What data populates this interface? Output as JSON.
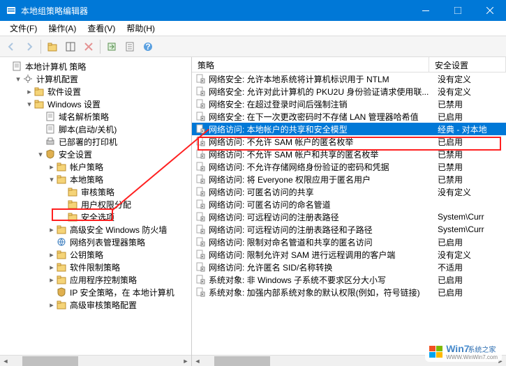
{
  "window": {
    "title": "本地组策略编辑器"
  },
  "menu": {
    "file": "文件(F)",
    "action": "操作(A)",
    "view": "查看(V)",
    "help": "帮助(H)"
  },
  "tree": {
    "root": "本地计算机 策略",
    "computer_config": "计算机配置",
    "software_settings": "软件设置",
    "windows_settings": "Windows 设置",
    "dns_policy": "域名解析策略",
    "scripts": "脚本(启动/关机)",
    "deployed_printers": "已部署的打印机",
    "security_settings": "安全设置",
    "account_policy": "帐户策略",
    "local_policy": "本地策略",
    "audit_policy": "审核策略",
    "user_rights": "用户权限分配",
    "security_options": "安全选项",
    "advanced_firewall": "高级安全 Windows 防火墙",
    "network_list": "网络列表管理器策略",
    "public_key": "公钥策略",
    "software_restriction": "软件限制策略",
    "app_control": "应用程序控制策略",
    "ip_security": "IP 安全策略，在 本地计算机",
    "advanced_audit": "高级审核策略配置"
  },
  "list": {
    "col_policy": "策略",
    "col_value": "安全设置",
    "rows": [
      {
        "p": "网络安全: 允许本地系统将计算机标识用于 NTLM",
        "v": "没有定义"
      },
      {
        "p": "网络安全: 允许对此计算机的 PKU2U 身份验证请求使用联...",
        "v": "没有定义"
      },
      {
        "p": "网络安全: 在超过登录时间后强制注销",
        "v": "已禁用"
      },
      {
        "p": "网络安全: 在下一次更改密码时不存储 LAN 管理器哈希值",
        "v": "已启用"
      },
      {
        "p": "网络访问: 本地帐户的共享和安全模型",
        "v": "经典 - 对本地"
      },
      {
        "p": "网络访问: 不允许 SAM 帐户的匿名枚举",
        "v": "已启用"
      },
      {
        "p": "网络访问: 不允许 SAM 帐户和共享的匿名枚举",
        "v": "已禁用"
      },
      {
        "p": "网络访问: 不允许存储网络身份验证的密码和凭据",
        "v": "已禁用"
      },
      {
        "p": "网络访问: 将 Everyone 权限应用于匿名用户",
        "v": "已禁用"
      },
      {
        "p": "网络访问: 可匿名访问的共享",
        "v": "没有定义"
      },
      {
        "p": "网络访问: 可匿名访问的命名管道",
        "v": ""
      },
      {
        "p": "网络访问: 可远程访问的注册表路径",
        "v": "System\\Curr"
      },
      {
        "p": "网络访问: 可远程访问的注册表路径和子路径",
        "v": "System\\Curr"
      },
      {
        "p": "网络访问: 限制对命名管道和共享的匿名访问",
        "v": "已启用"
      },
      {
        "p": "网络访问: 限制允许对 SAM 进行远程调用的客户端",
        "v": "没有定义"
      },
      {
        "p": "网络访问: 允许匿名 SID/名称转换",
        "v": "不适用"
      },
      {
        "p": "系统对象: 非 Windows 子系统不要求区分大小写",
        "v": "已启用"
      },
      {
        "p": "系统对象: 加强内部系统对象的默认权限(例如，符号链接)",
        "v": "已启用"
      }
    ],
    "selected_index": 4
  },
  "watermark": {
    "text": "Win7",
    "sub": "系统之家",
    "url": "WWW.WinWin7.com"
  }
}
